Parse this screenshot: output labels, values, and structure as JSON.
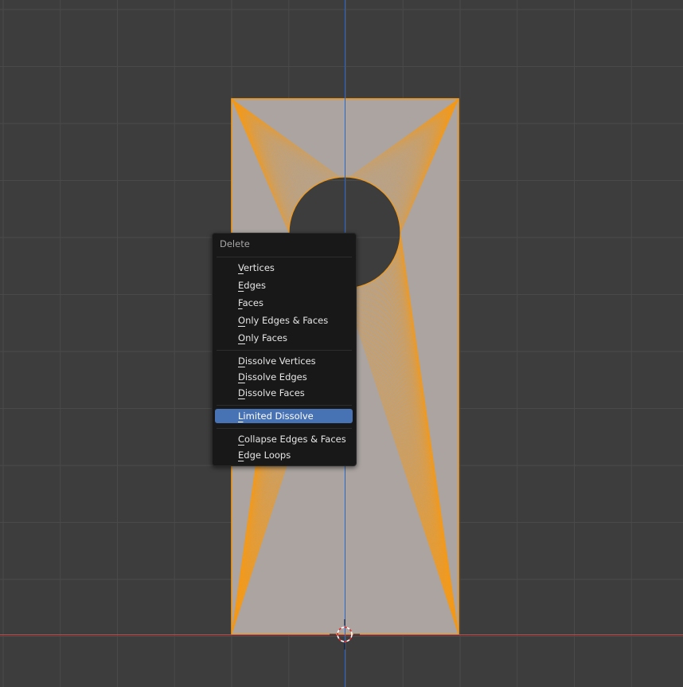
{
  "viewport": {
    "background_color": "#3d3d3d",
    "grid_color": "#4a4a4a",
    "x_axis_color": "#d14343",
    "y_axis_color": "#2a66c9",
    "mesh_face_color": "#aba4a1",
    "mesh_edge_color": "#f39a1b",
    "cursor_icon": "3d-cursor-icon"
  },
  "context_menu": {
    "title": "Delete",
    "groups": [
      [
        {
          "first": "V",
          "rest": "ertices"
        },
        {
          "first": "E",
          "rest": "dges"
        },
        {
          "first": "F",
          "rest": "aces"
        },
        {
          "first": "O",
          "rest": "nly Edges & Faces"
        },
        {
          "first": "O",
          "rest": "nly Faces"
        }
      ],
      [
        {
          "first": "D",
          "rest": "issolve Vertices"
        },
        {
          "first": "D",
          "rest": "issolve Edges"
        },
        {
          "first": "D",
          "rest": "issolve Faces"
        }
      ],
      [
        {
          "first": "L",
          "rest": "imited Dissolve",
          "highlighted": true
        }
      ],
      [
        {
          "first": "C",
          "rest": "ollapse Edges & Faces"
        },
        {
          "first": "E",
          "rest": "dge Loops"
        }
      ]
    ],
    "highlight_color": "#4772b3"
  }
}
